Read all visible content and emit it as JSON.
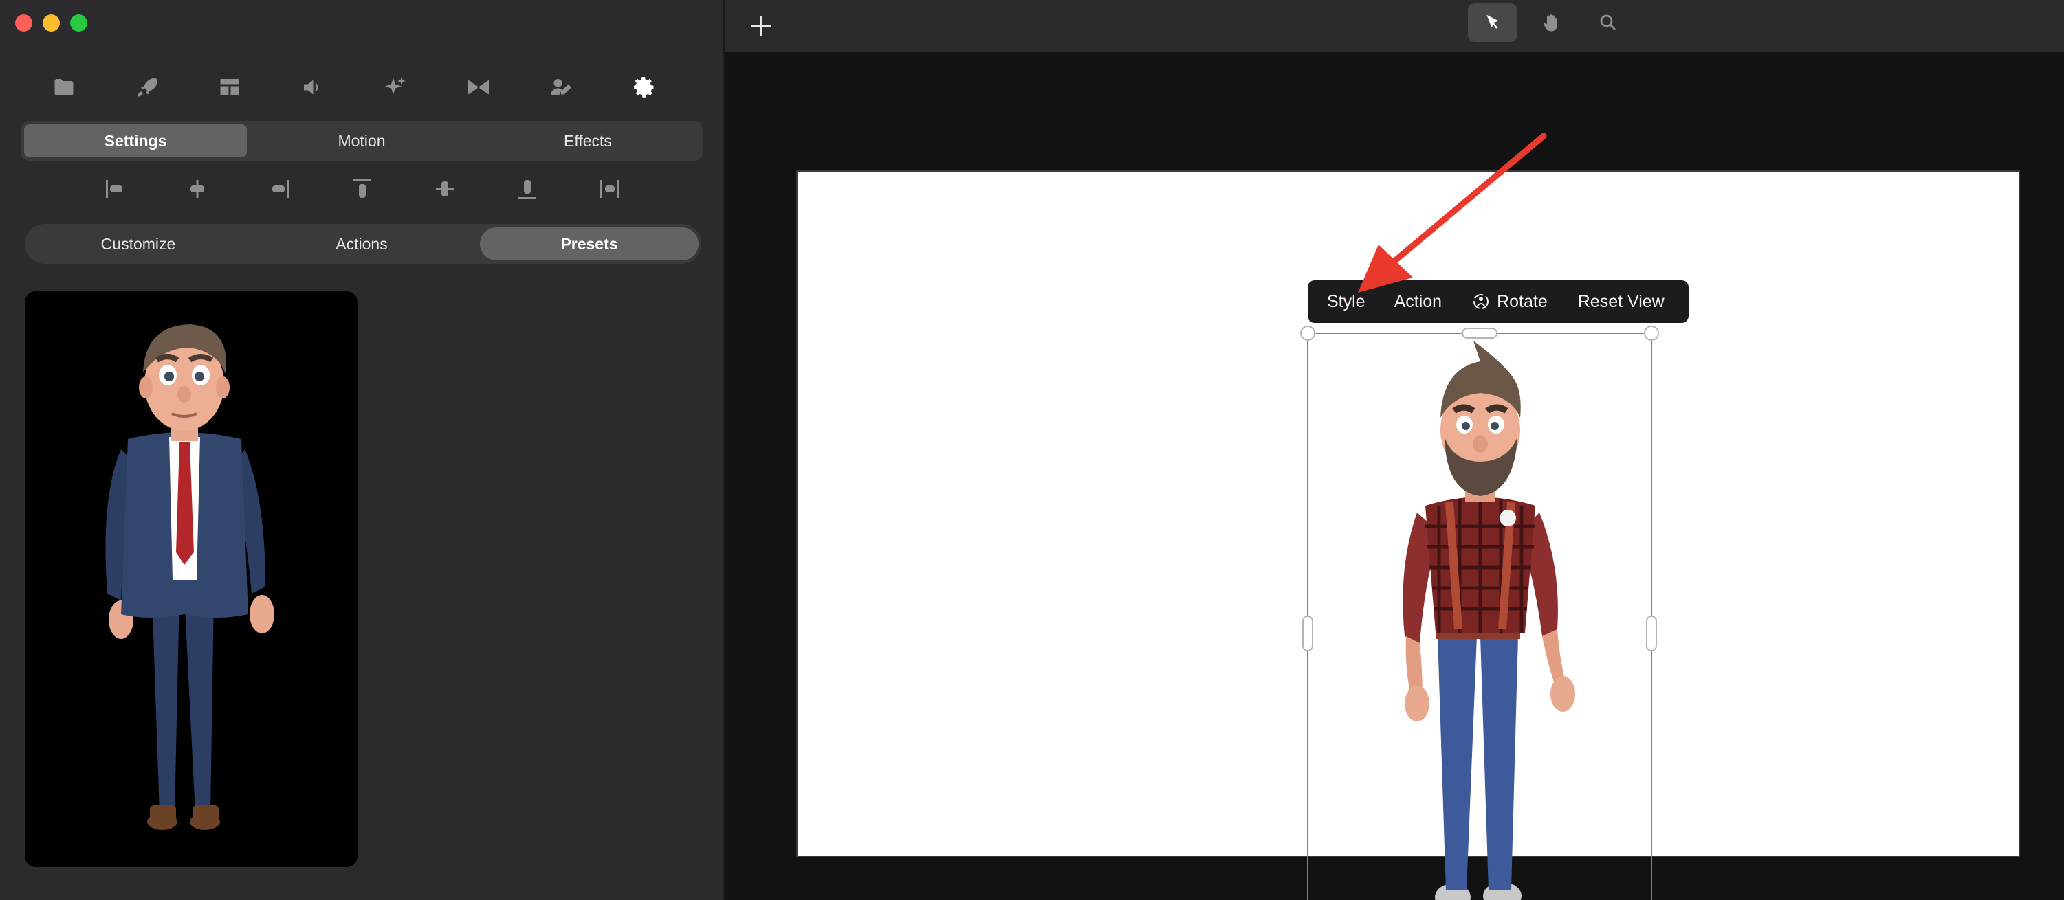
{
  "window": {
    "traffic_lights": [
      "close",
      "minimize",
      "maximize"
    ]
  },
  "left_panel": {
    "tool_icons": [
      {
        "name": "folder-icon",
        "active": false
      },
      {
        "name": "rocket-icon",
        "active": false
      },
      {
        "name": "layout-icon",
        "active": false
      },
      {
        "name": "speaker-icon",
        "active": false
      },
      {
        "name": "sparkle-icon",
        "active": false
      },
      {
        "name": "bowtie-icon",
        "active": false
      },
      {
        "name": "character-edit-icon",
        "active": false
      },
      {
        "name": "gear-icon",
        "active": true
      }
    ],
    "main_tabs": [
      {
        "label": "Settings",
        "selected": true
      },
      {
        "label": "Motion",
        "selected": false
      },
      {
        "label": "Effects",
        "selected": false
      }
    ],
    "alignment_icons": [
      "align-left-icon",
      "align-center-horizontal-icon",
      "align-right-icon",
      "align-top-icon",
      "align-center-vertical-icon",
      "align-bottom-icon",
      "distribute-horizontal-icon"
    ],
    "sub_tabs": [
      {
        "label": "Customize",
        "selected": false
      },
      {
        "label": "Actions",
        "selected": false
      },
      {
        "label": "Presets",
        "selected": true
      }
    ],
    "presets": [
      {
        "name": "businessman-preset",
        "background": "#000000"
      }
    ]
  },
  "top_toolbar": {
    "add_icon": "plus-icon",
    "tools": [
      {
        "name": "select-pointer-icon",
        "active": true
      },
      {
        "name": "hand-pan-icon",
        "active": false
      },
      {
        "name": "zoom-magnifier-icon",
        "active": false
      }
    ]
  },
  "canvas": {
    "artboard_color": "#ffffff",
    "context_toolbar": {
      "style_label": "Style",
      "action_label": "Action",
      "rotate_label": "Rotate",
      "reset_label": "Reset View"
    },
    "selection_color": "#a259ff",
    "character": "lumberjack-character"
  },
  "annotation": {
    "arrow_color": "#e8392c"
  },
  "colors": {
    "panel_bg": "#2b2b2d",
    "canvas_bg": "#121212",
    "segment_bg": "#3a3a3c",
    "segment_selected": "#636366"
  }
}
